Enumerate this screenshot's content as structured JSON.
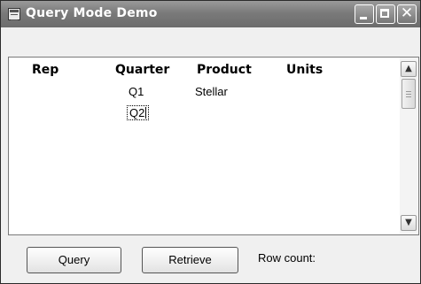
{
  "window": {
    "title": "Query Mode Demo"
  },
  "grid": {
    "columns": [
      "Rep",
      "Quarter",
      "Product",
      "Units"
    ],
    "rows": [
      {
        "rep": "",
        "quarter": "Q1",
        "product": "Stellar",
        "units": ""
      },
      {
        "rep": "",
        "quarter": "Q2",
        "product": "",
        "units": ""
      }
    ]
  },
  "buttons": {
    "query": "Query",
    "retrieve": "Retrieve"
  },
  "status": {
    "row_count_label": "Row count:"
  }
}
